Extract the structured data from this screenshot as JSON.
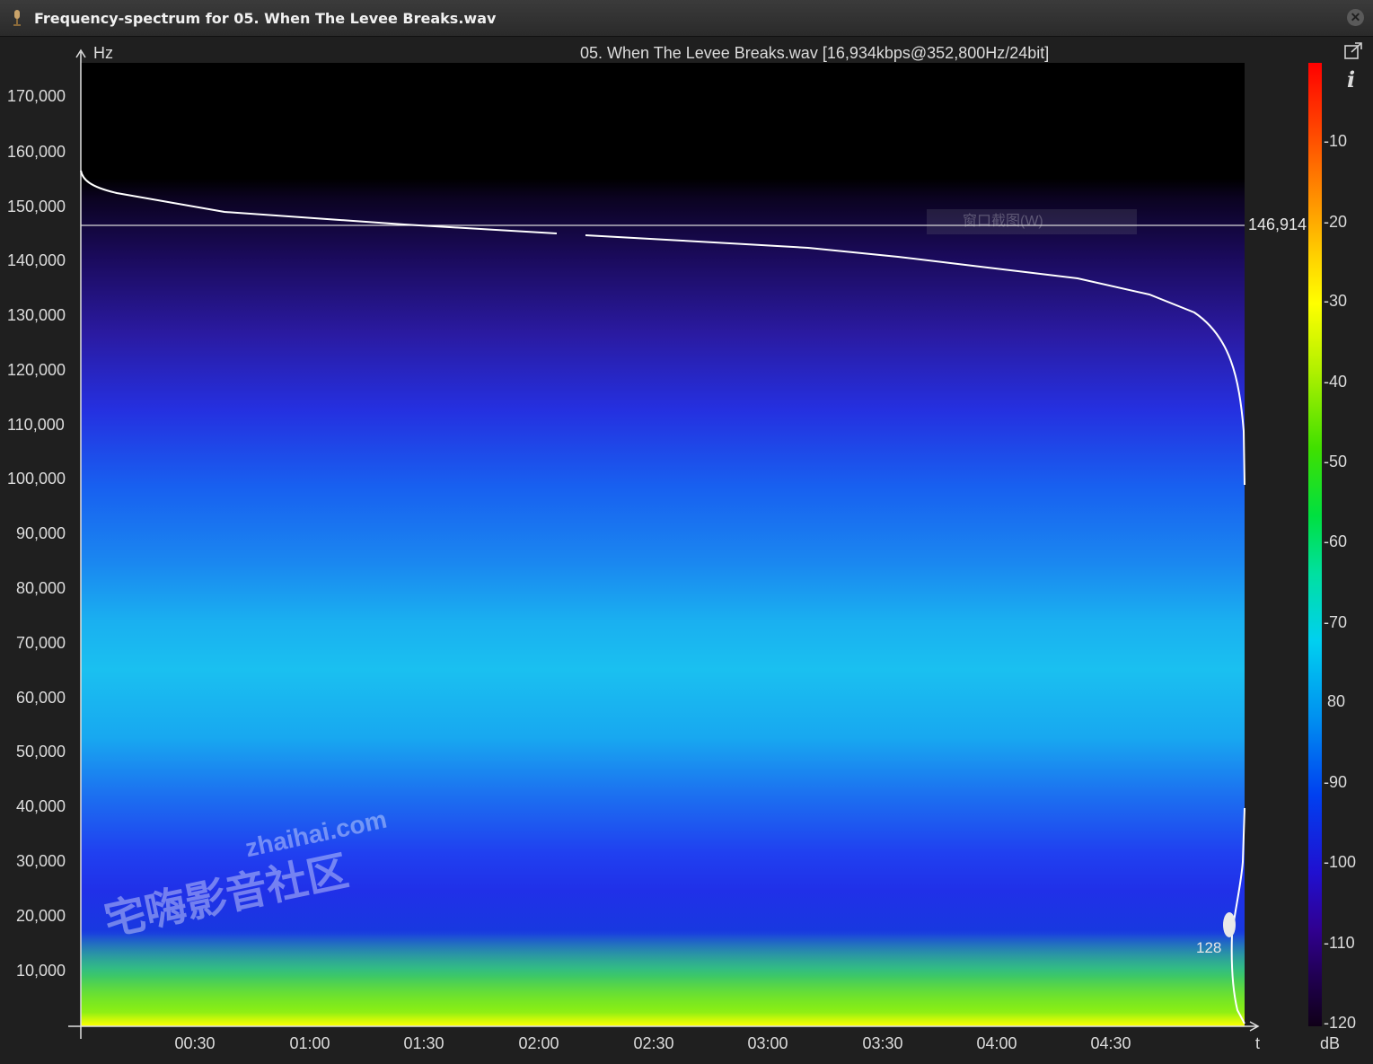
{
  "window": {
    "title": "Frequency-spectrum for 05. When The Levee Breaks.wav",
    "close_icon": "close-icon",
    "app_icon": "microphone-icon"
  },
  "plot": {
    "title": "05. When The Levee Breaks.wav [16,934kbps@352,800Hz/24bit]",
    "y_unit": "Hz",
    "x_unit": "t",
    "colorbar_unit": "dB",
    "cutoff_value": "146,914",
    "marker_label": "128",
    "ghost_tooltip": "窗口截图(W)"
  },
  "y_axis": {
    "ticks": [
      "170,000",
      "160,000",
      "150,000",
      "140,000",
      "130,000",
      "120,000",
      "110,000",
      "100,000",
      "90,000",
      "80,000",
      "70,000",
      "60,000",
      "50,000",
      "40,000",
      "30,000",
      "20,000",
      "10,000"
    ]
  },
  "x_axis": {
    "ticks": [
      "00:30",
      "01:00",
      "01:30",
      "02:00",
      "02:30",
      "03:00",
      "03:30",
      "04:00",
      "04:30"
    ]
  },
  "colorbar": {
    "ticks": [
      "-10",
      "-20",
      "-30",
      "-40",
      "-50",
      "-60",
      "-70",
      "80",
      "-90",
      "-100",
      "-110",
      "-120"
    ]
  },
  "watermark": {
    "url": "zhaihai.com",
    "text": "宅嗨影音社区"
  },
  "toolbar": {
    "export_icon": "external-link-icon",
    "info_icon": "info-icon",
    "info_label": "i"
  }
}
